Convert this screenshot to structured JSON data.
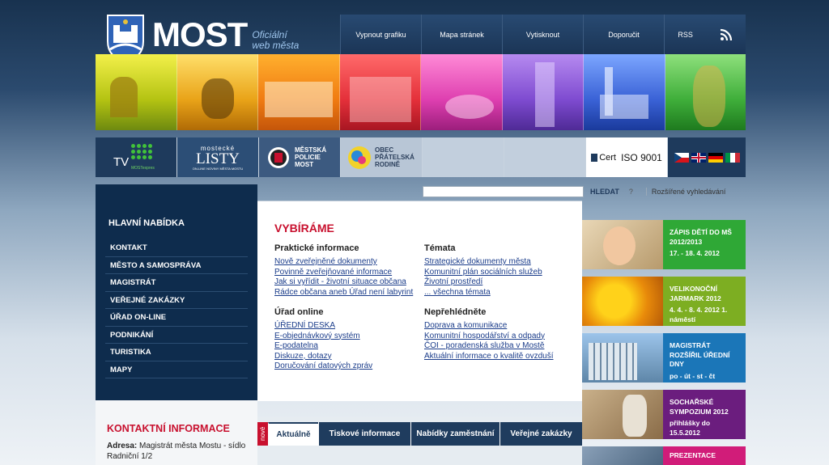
{
  "header": {
    "brand": "MOST",
    "subtitle_1": "Oficiální",
    "subtitle_2": "web města"
  },
  "topnav": [
    "Vypnout grafiku",
    "Mapa stránek",
    "Vytisknout",
    "Doporučit",
    "RSS"
  ],
  "logos": {
    "tv": "TV",
    "tv_sub": "MOSTexpres",
    "listy_top": "mostecké",
    "listy": "LISTY",
    "listy_sub": "ON-LINE NOVINY MĚSTA MOSTU",
    "policie": "MĚSTSKÁ POLICIE MOST",
    "rodina": "OBEC PŘÁTELSKÁ RODINĚ",
    "cert": "Cert",
    "iso": "ISO 9001"
  },
  "search": {
    "placeholder": "",
    "button": "HLEDAT",
    "help": "?",
    "advanced": "Rozšířené vyhledávání"
  },
  "leftnav": {
    "title": "HLAVNÍ NABÍDKA",
    "items": [
      "KONTAKT",
      "MĚSTO A SAMOSPRÁVA",
      "MAGISTRÁT",
      "VEŘEJNÉ ZAKÁZKY",
      "ÚŘAD ON-LINE",
      "PODNIKÁNÍ",
      "TURISTIKA",
      "MAPY"
    ]
  },
  "contact": {
    "title": "KONTAKTNÍ INFORMACE",
    "label": "Adresa:",
    "line1": "Magistrát města Mostu - sídlo",
    "line2": "Radniční 1/2"
  },
  "center": {
    "title": "VYBÍRÁME",
    "col1": [
      {
        "heading": "Praktické informace",
        "links": [
          "Nově zveřejněné dokumenty",
          "Povinně zveřejňované informace",
          "Jak si vyřídit - životní situace občana",
          "Rádce občana aneb Úřad není labyrint"
        ]
      },
      {
        "heading": "Úřad online",
        "links": [
          "ÚŘEDNÍ DESKA",
          "E-objednávkový systém",
          "E-podatelna",
          "Diskuze, dotazy",
          "Doručování datových zpráv"
        ]
      }
    ],
    "col2": [
      {
        "heading": "Témata",
        "links": [
          "Strategické dokumenty města",
          "Komunitní plán sociálních služeb",
          "Životní prostředí",
          "... všechna témata"
        ]
      },
      {
        "heading": "Nepřehlédněte",
        "links": [
          "Doprava a komunikace",
          "Komunitní hospodářství a odpady",
          "ČOI - poradenská služba v Mostě",
          "Aktuální informace o kvalitě ovzduší"
        ]
      }
    ]
  },
  "tabs": {
    "new": "nové",
    "items": [
      "Aktuálně",
      "Tiskové informace",
      "Nabídky zaměstnání",
      "Veřejné zakázky"
    ]
  },
  "banners": [
    {
      "t": "ZÁPIS DĚTÍ DO MŠ 2012/2013",
      "d": "17. - 18. 4. 2012",
      "color": "#2fa836"
    },
    {
      "t": "VELIKONOČNÍ JARMARK 2012",
      "d": "4. 4. - 8. 4. 2012 1. náměstí",
      "color": "#7dae22"
    },
    {
      "t": "MAGISTRÁT ROZŠÍŘIL ÚŘEDNÍ DNY",
      "d": "po - út - st - čt",
      "color": "#1b76b8"
    },
    {
      "t": "SOCHAŘSKÉ SYMPOZIUM 2012",
      "d": "přihlášky do 15.5.2012",
      "color": "#6b1d7e"
    },
    {
      "t": "PREZENTACE",
      "d": "",
      "color": "#d11c79"
    }
  ]
}
